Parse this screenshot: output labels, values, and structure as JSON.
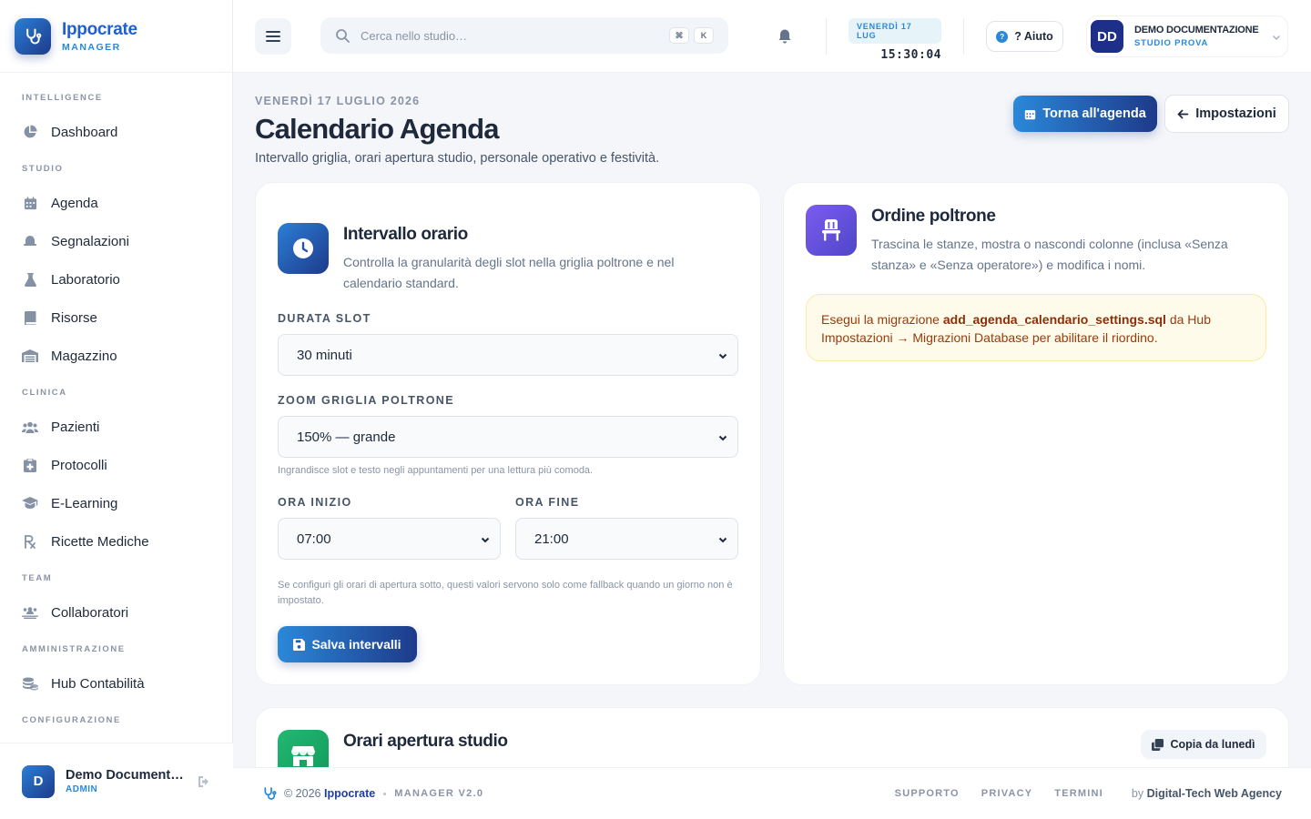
{
  "brand": {
    "name": "Ippocrate",
    "subtitle": "MANAGER"
  },
  "sidebar": {
    "sections": [
      {
        "title": "INTELLIGENCE",
        "items": [
          {
            "label": "Dashboard",
            "icon": "chart-pie-icon"
          }
        ]
      },
      {
        "title": "STUDIO",
        "items": [
          {
            "label": "Agenda",
            "icon": "calendar-icon"
          },
          {
            "label": "Segnalazioni",
            "icon": "bell-icon"
          },
          {
            "label": "Laboratorio",
            "icon": "flask-icon"
          },
          {
            "label": "Risorse",
            "icon": "book-icon"
          },
          {
            "label": "Magazzino",
            "icon": "warehouse-icon"
          }
        ]
      },
      {
        "title": "CLINICA",
        "items": [
          {
            "label": "Pazienti",
            "icon": "users-icon"
          },
          {
            "label": "Protocolli",
            "icon": "clipboard-icon"
          },
          {
            "label": "E-Learning",
            "icon": "graduation-cap-icon"
          },
          {
            "label": "Ricette Mediche",
            "icon": "prescription-icon"
          }
        ]
      },
      {
        "title": "TEAM",
        "items": [
          {
            "label": "Collaboratori",
            "icon": "id-card-icon"
          }
        ]
      },
      {
        "title": "AMMINISTRAZIONE",
        "items": [
          {
            "label": "Hub Contabilità",
            "icon": "coins-icon"
          }
        ]
      },
      {
        "title": "CONFIGURAZIONE",
        "items": []
      }
    ],
    "user": {
      "initial": "D",
      "name": "Demo Documentazione",
      "role": "ADMIN"
    }
  },
  "topbar": {
    "search_placeholder": "Cerca nello studio…",
    "shortcut_keys": [
      "⌘",
      "K"
    ],
    "clock_date": "VENERDÌ 17 LUG",
    "clock_time": "15:30:04",
    "help_label": "? Aiuto",
    "user": {
      "initials": "DD",
      "name": "DEMO DOCUMENTAZIONE",
      "studio": "STUDIO PROVA"
    }
  },
  "page": {
    "date": "VENERDÌ 17 LUGLIO 2026",
    "title": "Calendario Agenda",
    "subtitle": "Intervallo griglia, orari apertura studio, personale operativo e festività.",
    "primary_button": "Torna all'agenda",
    "secondary_button": "Impostazioni"
  },
  "interval_card": {
    "title": "Intervallo orario",
    "description": "Controlla la granularità degli slot nella griglia poltrone e nel calendario standard.",
    "slot_label": "DURATA SLOT",
    "slot_value": "30 minuti",
    "zoom_label": "ZOOM GRIGLIA POLTRONE",
    "zoom_value": "150% — grande",
    "zoom_hint": "Ingrandisce slot e testo negli appuntamenti per una lettura più comoda.",
    "start_label": "ORA INIZIO",
    "start_value": "07:00",
    "end_label": "ORA FINE",
    "end_value": "21:00",
    "fallback_hint": "Se configuri gli orari di apertura sotto, questi valori servono solo come fallback quando un giorno non è impostato.",
    "save_button": "Salva intervalli"
  },
  "chairs_card": {
    "title": "Ordine poltrone",
    "description": "Trascina le stanze, mostra o nascondi colonne (inclusa «Senza stanza» e «Senza operatore») e modifica i nomi.",
    "alert_prefix": "Esegui la migrazione ",
    "alert_file": "add_agenda_calendario_settings.sql",
    "alert_suffix": " da Hub Impostazioni → Migrazioni Database per abilitare il riordino."
  },
  "hours_card": {
    "title": "Orari apertura studio",
    "copy_button": "Copia da lunedì"
  },
  "footer": {
    "copyright_prefix": "© 2026 ",
    "copyright_brand": "Ippocrate",
    "version": "MANAGER V2.0",
    "links": [
      "SUPPORTO",
      "PRIVACY",
      "TERMINI"
    ],
    "by_prefix": "by ",
    "by_agency": "Digital-Tech Web Agency"
  },
  "colors": {
    "primary": "#2b88d9",
    "primary_dark": "#1e3a8a",
    "chairs_icon": "#6d4de0",
    "hours_icon": "#16a86a",
    "alert_bg": "#fffbeb"
  }
}
